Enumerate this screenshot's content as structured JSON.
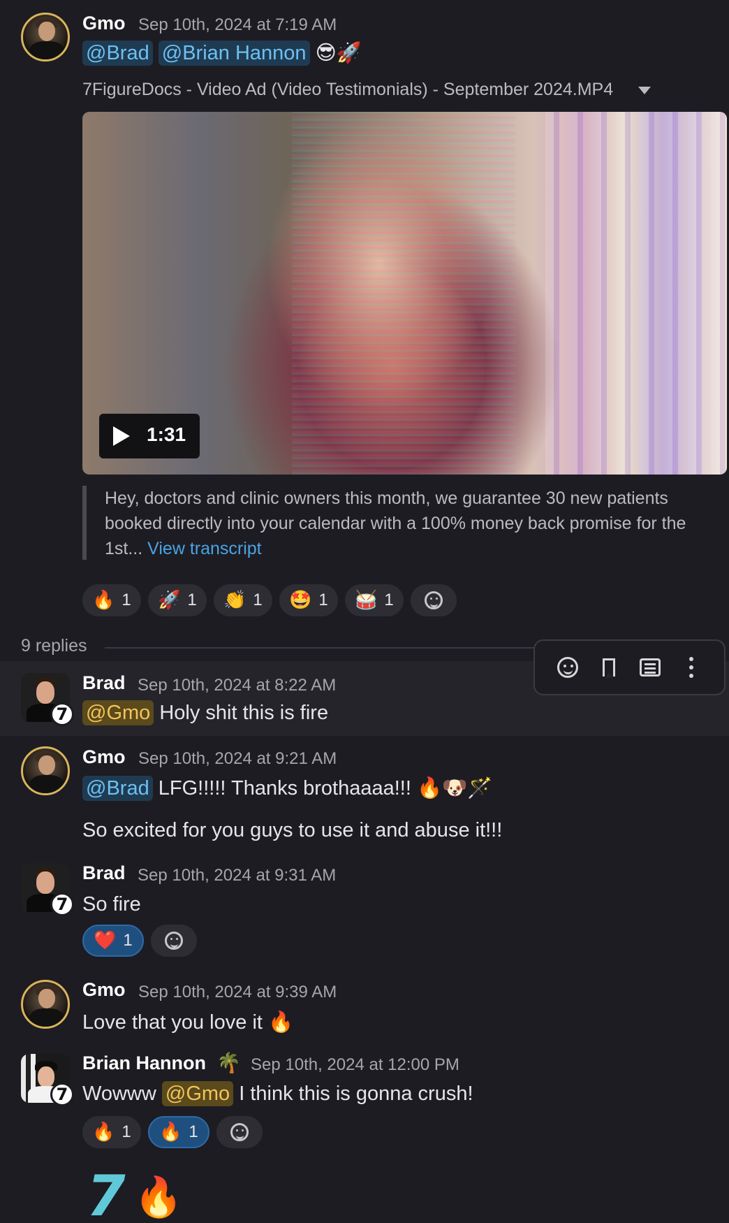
{
  "messages": [
    {
      "author": "Gmo",
      "time": "Sep 10th, 2024 at 7:19 AM",
      "mentions": [
        "@Brad",
        "@Brian Hannon"
      ],
      "emojis": "😎🚀",
      "file": {
        "title": "7FigureDocs - Video Ad (Video Testimonials) - September 2024.MP4",
        "duration": "1:31"
      },
      "transcript": {
        "text": "Hey, doctors and clinic owners this month, we guarantee 30 new patients booked directly into your calendar with a 100% money back promise for the 1st...",
        "link": "View transcript"
      },
      "reactions": [
        {
          "emoji": "🔥",
          "count": "1"
        },
        {
          "emoji": "🚀",
          "count": "1"
        },
        {
          "emoji": "👏",
          "count": "1"
        },
        {
          "emoji": "🤩",
          "count": "1"
        },
        {
          "emoji": "🥁",
          "count": "1"
        }
      ]
    }
  ],
  "thread": {
    "replies_label": "9 replies",
    "replies": [
      {
        "author": "Brad",
        "time": "Sep 10th, 2024 at 8:22 AM",
        "mention": "@Gmo",
        "text": " Holy shit this is fire"
      },
      {
        "author": "Gmo",
        "time": "Sep 10th, 2024 at 9:21 AM",
        "mention": "@Brad",
        "text": " LFG!!!!! Thanks brothaaaa!!! ",
        "emojis": "🔥🐶🪄",
        "text2": "So excited for you guys to use it and abuse it!!!"
      },
      {
        "author": "Brad",
        "time": "Sep 10th, 2024 at 9:31 AM",
        "text": "So fire",
        "reactions": [
          {
            "emoji": "❤️",
            "count": "1"
          }
        ]
      },
      {
        "author": "Gmo",
        "time": "Sep 10th, 2024 at 9:39 AM",
        "text": "Love that you love it ",
        "emojis": "🔥"
      },
      {
        "author": "Brian Hannon",
        "status_emoji": "🌴",
        "time": "Sep 10th, 2024 at 12:00 PM",
        "pre": "Wowww ",
        "mention": "@Gmo",
        "text": " I think this is gonna crush!",
        "reactions": [
          {
            "emoji": "🔥",
            "count": "1"
          },
          {
            "emoji": "🔥",
            "count": "1"
          }
        ]
      }
    ]
  },
  "toolbar": {
    "icons": [
      "add-reaction-icon",
      "bookmark-icon",
      "checklist-icon",
      "more-icon"
    ]
  },
  "avatar_badge": "7",
  "footer": {
    "mark": "7",
    "emoji": "🔥"
  },
  "colors": {
    "background": "#1d1c23",
    "mention_bg": "#1f3b52",
    "mention_text": "#6dc0f2",
    "self_mention_bg": "#5a4a1c",
    "self_mention_text": "#f3c358",
    "link": "#4aa4e4",
    "active_reaction": "#1f4f7e"
  }
}
